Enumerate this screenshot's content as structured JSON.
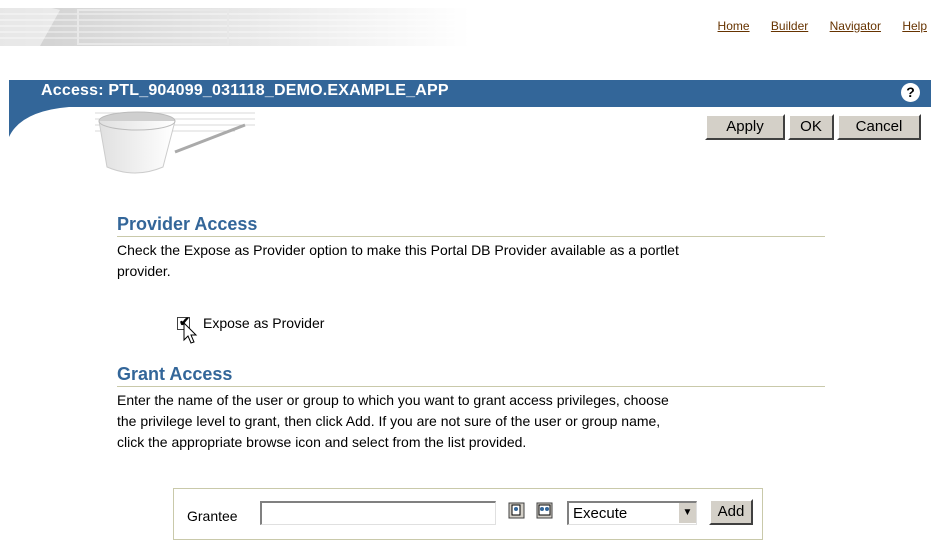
{
  "nav": {
    "home": "Home",
    "builder": "Builder",
    "navigator": "Navigator",
    "help": "Help"
  },
  "header": {
    "title": "Access: PTL_904099_031118_DEMO.EXAMPLE_APP",
    "help_glyph": "?"
  },
  "actions": {
    "apply": "Apply",
    "ok": "OK",
    "cancel": "Cancel"
  },
  "provider_access": {
    "heading": "Provider Access",
    "line1": "Check the Expose as Provider option to make this Portal DB Provider available as a portlet",
    "line2": "provider.",
    "checkbox_label": "Expose as Provider",
    "checked": true
  },
  "grant_access": {
    "heading": "Grant Access",
    "line1": "Enter the name of the user or group to which you want to grant access privileges, choose",
    "line2": "the privilege level to grant, then click Add. If you are not sure of the user or group name,",
    "line3": "click the appropriate browse icon and select from the list provided.",
    "grantee_label": "Grantee",
    "grantee_value": "",
    "privilege_selected": "Execute",
    "add_label": "Add"
  }
}
